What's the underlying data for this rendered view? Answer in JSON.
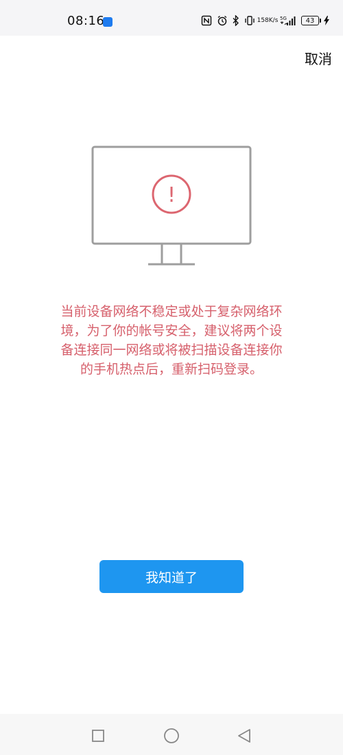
{
  "status_bar": {
    "time": "08:16",
    "net_speed_value": "158",
    "net_speed_unit": "K/s",
    "battery_level": "43",
    "icons": [
      "app-icon",
      "nfc-icon",
      "alarm-icon",
      "bluetooth-icon",
      "vibrate-icon",
      "signal-5g-icon",
      "charging-icon"
    ]
  },
  "header": {
    "cancel_label": "取消"
  },
  "illustration": {
    "icon": "monitor-warning-icon",
    "symbol": "!",
    "monitor_color": "#9e9e9e",
    "alert_color": "#dc6670"
  },
  "message": {
    "text": "当前设备网络不稳定或处于复杂网络环境，为了你的帐号安全，建议将两个设备连接同一网络或将被扫描设备连接你的手机热点后，重新扫码登录。",
    "color": "#d6606c"
  },
  "actions": {
    "confirm_label": "我知道了",
    "confirm_color": "#1e96f0"
  },
  "navigation": {
    "items": [
      "recent-apps-icon",
      "home-icon",
      "back-icon"
    ]
  }
}
